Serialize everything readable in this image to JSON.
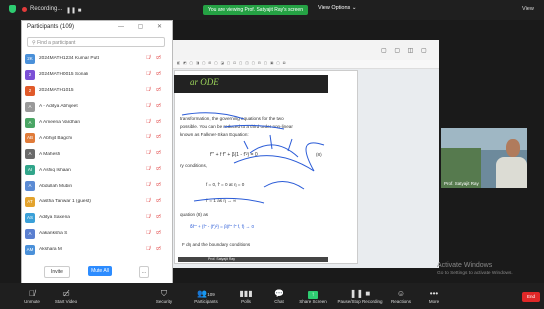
{
  "topbar": {
    "recording_label": "Recording...",
    "viewing_banner": "You are viewing Prof. Satyajit Ray's screen",
    "view_options": "View Options",
    "view_button": "View"
  },
  "participants_panel": {
    "title": "Participants (109)",
    "search_placeholder": "Find a participant",
    "participants": [
      {
        "initials": "2K",
        "name": "2024MATH1234 Kumar Putt",
        "color": "#4a90d9"
      },
      {
        "initials": "2",
        "name": "2024MATH0015 Sonali",
        "color": "#7b4fd6"
      },
      {
        "initials": "2",
        "name": "2024MATH1015",
        "color": "#e05a2a"
      },
      {
        "initials": "A",
        "name": "A - Aditya Abhijeet",
        "color": "#999999"
      },
      {
        "initials": "A",
        "name": "A Ameena Vardhan",
        "color": "#4aa564"
      },
      {
        "initials": "AB",
        "name": "A Abhijit Bagchi",
        "color": "#e07b39"
      },
      {
        "initials": "A",
        "name": "A Mahesh",
        "color": "#6a6a6a"
      },
      {
        "initials": "AI",
        "name": "A Ashiq Ishaan",
        "color": "#31a58a"
      },
      {
        "initials": "A",
        "name": "Abdullah Mubin",
        "color": "#5b8bd4"
      },
      {
        "initials": "AT",
        "name": "Aastha Tanwar 1 (guest)",
        "color": "#e3a32d"
      },
      {
        "initials": "AS",
        "name": "Aditya Saxena",
        "color": "#3aa0d8"
      },
      {
        "initials": "A",
        "name": "Aakanksha S",
        "color": "#5a7fd0"
      },
      {
        "initials": "AM",
        "name": "Akshara M",
        "color": "#4a90d9"
      }
    ],
    "invite_label": "Invite",
    "mute_all_label": "Mute All",
    "more_label": "..."
  },
  "slide": {
    "title": "ar ODE",
    "line1": "transformation, the governing equations for the two",
    "line2": "possible. You can be reduced to a third order non-linear",
    "line3": "known as Falkner-Skan Equation:",
    "eq1": "f''' + f f'' + β(1 - f'²) = 0",
    "eq_num": "(8)",
    "line4": "ry conditions,",
    "bc": "f = 0,  f' = 0   at   η = 0",
    "line5": "f' = 1   as   η → ∞",
    "line6": "quation (8) as",
    "eq2": "ẟf''' + {f'' - (f')²} = β(f''' f'' f, f) → 0",
    "line7": "F dη      and the boundary conditions",
    "footer": "Prof. Satyajit Ray"
  },
  "video": {
    "name": "Prof. Satyajit Ray"
  },
  "watermark": {
    "line1": "Activate Windows",
    "line2": "Go to Settings to activate Windows."
  },
  "bottom_bar": {
    "unmute": "Unmute",
    "start_video": "Start Video",
    "security": "Security",
    "participants": "Participants",
    "participants_count": "109",
    "polls": "Polls",
    "chat": "Chat",
    "share_screen": "Share Screen",
    "pause_recording": "Pause/Stop Recording",
    "reactions": "Reactions",
    "more": "More",
    "end": "End"
  }
}
